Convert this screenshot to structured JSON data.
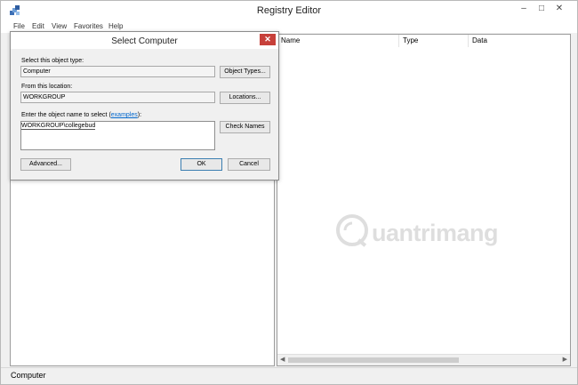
{
  "app": {
    "title": "Registry Editor",
    "window_buttons": {
      "minimize": "–",
      "maximize": "□",
      "close": "✕"
    }
  },
  "menu": [
    "File",
    "Edit",
    "View",
    "Favorites",
    "Help"
  ],
  "list": {
    "columns": [
      "Name",
      "Type",
      "Data"
    ]
  },
  "status": {
    "path": "Computer"
  },
  "watermark": {
    "text": "uantrimang"
  },
  "dialog": {
    "title": "Select Computer",
    "close": "✕",
    "object_type_label": "Select this object type:",
    "object_type_value": "Computer",
    "object_types_button": "Object Types...",
    "location_label": "From this location:",
    "location_value": "WORKGROUP",
    "locations_button": "Locations...",
    "name_label_prefix": "Enter the object name to select (",
    "name_label_link": "examples",
    "name_label_suffix": "):",
    "name_value": "WORKGROUP\\collegebud",
    "check_names_button": "Check Names",
    "advanced_button": "Advanced...",
    "ok_button": "OK",
    "cancel_button": "Cancel"
  },
  "colors": {
    "close_red": "#c7403a",
    "link_blue": "#0066cc",
    "chrome_gray": "#f0f0f0"
  }
}
